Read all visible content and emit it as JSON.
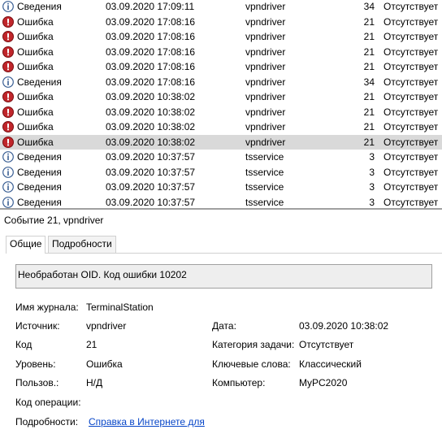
{
  "events": [
    {
      "type": "info",
      "level": "Сведения",
      "date": "03.09.2020 17:09:11",
      "source": "vpndriver",
      "id": "34",
      "category": "Отсутствует",
      "selected": false
    },
    {
      "type": "error",
      "level": "Ошибка",
      "date": "03.09.2020 17:08:16",
      "source": "vpndriver",
      "id": "21",
      "category": "Отсутствует",
      "selected": false
    },
    {
      "type": "error",
      "level": "Ошибка",
      "date": "03.09.2020 17:08:16",
      "source": "vpndriver",
      "id": "21",
      "category": "Отсутствует",
      "selected": false
    },
    {
      "type": "error",
      "level": "Ошибка",
      "date": "03.09.2020 17:08:16",
      "source": "vpndriver",
      "id": "21",
      "category": "Отсутствует",
      "selected": false
    },
    {
      "type": "error",
      "level": "Ошибка",
      "date": "03.09.2020 17:08:16",
      "source": "vpndriver",
      "id": "21",
      "category": "Отсутствует",
      "selected": false
    },
    {
      "type": "info",
      "level": "Сведения",
      "date": "03.09.2020 17:08:16",
      "source": "vpndriver",
      "id": "34",
      "category": "Отсутствует",
      "selected": false
    },
    {
      "type": "error",
      "level": "Ошибка",
      "date": "03.09.2020 10:38:02",
      "source": "vpndriver",
      "id": "21",
      "category": "Отсутствует",
      "selected": false
    },
    {
      "type": "error",
      "level": "Ошибка",
      "date": "03.09.2020 10:38:02",
      "source": "vpndriver",
      "id": "21",
      "category": "Отсутствует",
      "selected": false
    },
    {
      "type": "error",
      "level": "Ошибка",
      "date": "03.09.2020 10:38:02",
      "source": "vpndriver",
      "id": "21",
      "category": "Отсутствует",
      "selected": false
    },
    {
      "type": "error",
      "level": "Ошибка",
      "date": "03.09.2020 10:38:02",
      "source": "vpndriver",
      "id": "21",
      "category": "Отсутствует",
      "selected": true
    },
    {
      "type": "info",
      "level": "Сведения",
      "date": "03.09.2020 10:37:57",
      "source": "tsservice",
      "id": "3",
      "category": "Отсутствует",
      "selected": false
    },
    {
      "type": "info",
      "level": "Сведения",
      "date": "03.09.2020 10:37:57",
      "source": "tsservice",
      "id": "3",
      "category": "Отсутствует",
      "selected": false
    },
    {
      "type": "info",
      "level": "Сведения",
      "date": "03.09.2020 10:37:57",
      "source": "tsservice",
      "id": "3",
      "category": "Отсутствует",
      "selected": false
    },
    {
      "type": "info",
      "level": "Сведения",
      "date": "03.09.2020 10:37:57",
      "source": "tsservice",
      "id": "3",
      "category": "Отсутствует",
      "selected": false
    }
  ],
  "colors": {
    "error_icon": "#c0262b",
    "info_icon": "#ffffff",
    "info_border": "#3a5f94",
    "selected_row": "#d9d9d9",
    "link": "#0645c8"
  },
  "detail": {
    "header": "Событие 21, vpndriver",
    "tabs": {
      "general": "Общие",
      "details": "Подробности"
    },
    "message": "Необработан OID. Код ошибки 10202",
    "labels": {
      "log_name": "Имя журнала:",
      "source": "Источник:",
      "code": "Код",
      "level": "Уровень:",
      "user": "Пользов.:",
      "opcode": "Код операции:",
      "more_info": "Подробности:",
      "date": "Дата:",
      "task_category": "Категория задачи:",
      "keywords": "Ключевые слова:",
      "computer": "Компьютер:"
    },
    "values": {
      "log_name": "TerminalStation",
      "source": "vpndriver",
      "code": "21",
      "level": "Ошибка",
      "user": "Н/Д",
      "date": "03.09.2020 10:38:02",
      "task_category": "Отсутствует",
      "keywords": "Классический",
      "computer": "MyPC2020",
      "help_link": "Справка в Интернете для"
    }
  }
}
